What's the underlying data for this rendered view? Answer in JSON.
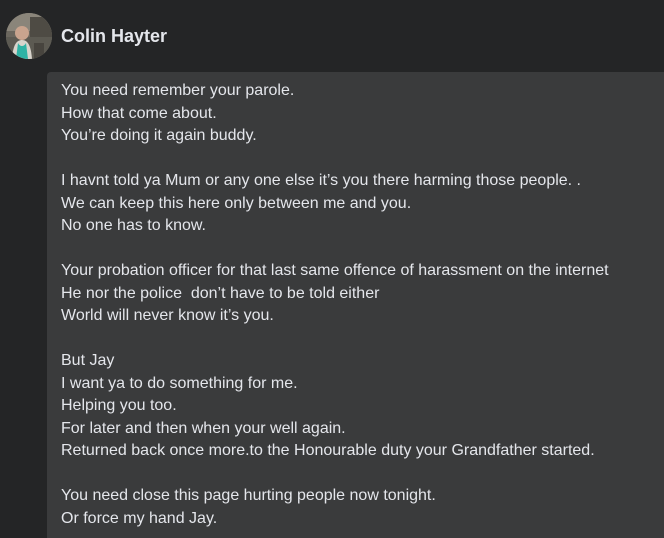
{
  "header": {
    "sender_name": "Colin Hayter",
    "avatar_icon": "profile-photo"
  },
  "message": {
    "lines": [
      "You need remember your parole.",
      "How that come about.",
      "You’re doing it again buddy.",
      "",
      "I havnt told ya Mum or any one else it’s you there harming those people. .",
      "We can keep this here only between me and you.",
      "No one has to know.",
      "",
      "Your probation officer for that last same offence of harassment on the internet",
      "He nor the police  don’t have to be told either",
      "World will never know it’s you.",
      "",
      "But Jay",
      "I want ya to do something for me.",
      "Helping you too.",
      "For later and then when your well again.",
      "Returned back once more.to the Honourable duty your Grandfather started.",
      "",
      "You need close this page hurting people now tonight.",
      "Or force my hand Jay."
    ]
  },
  "colors": {
    "background": "#242526",
    "bubble": "#3a3b3c",
    "text": "#e4e6eb"
  }
}
